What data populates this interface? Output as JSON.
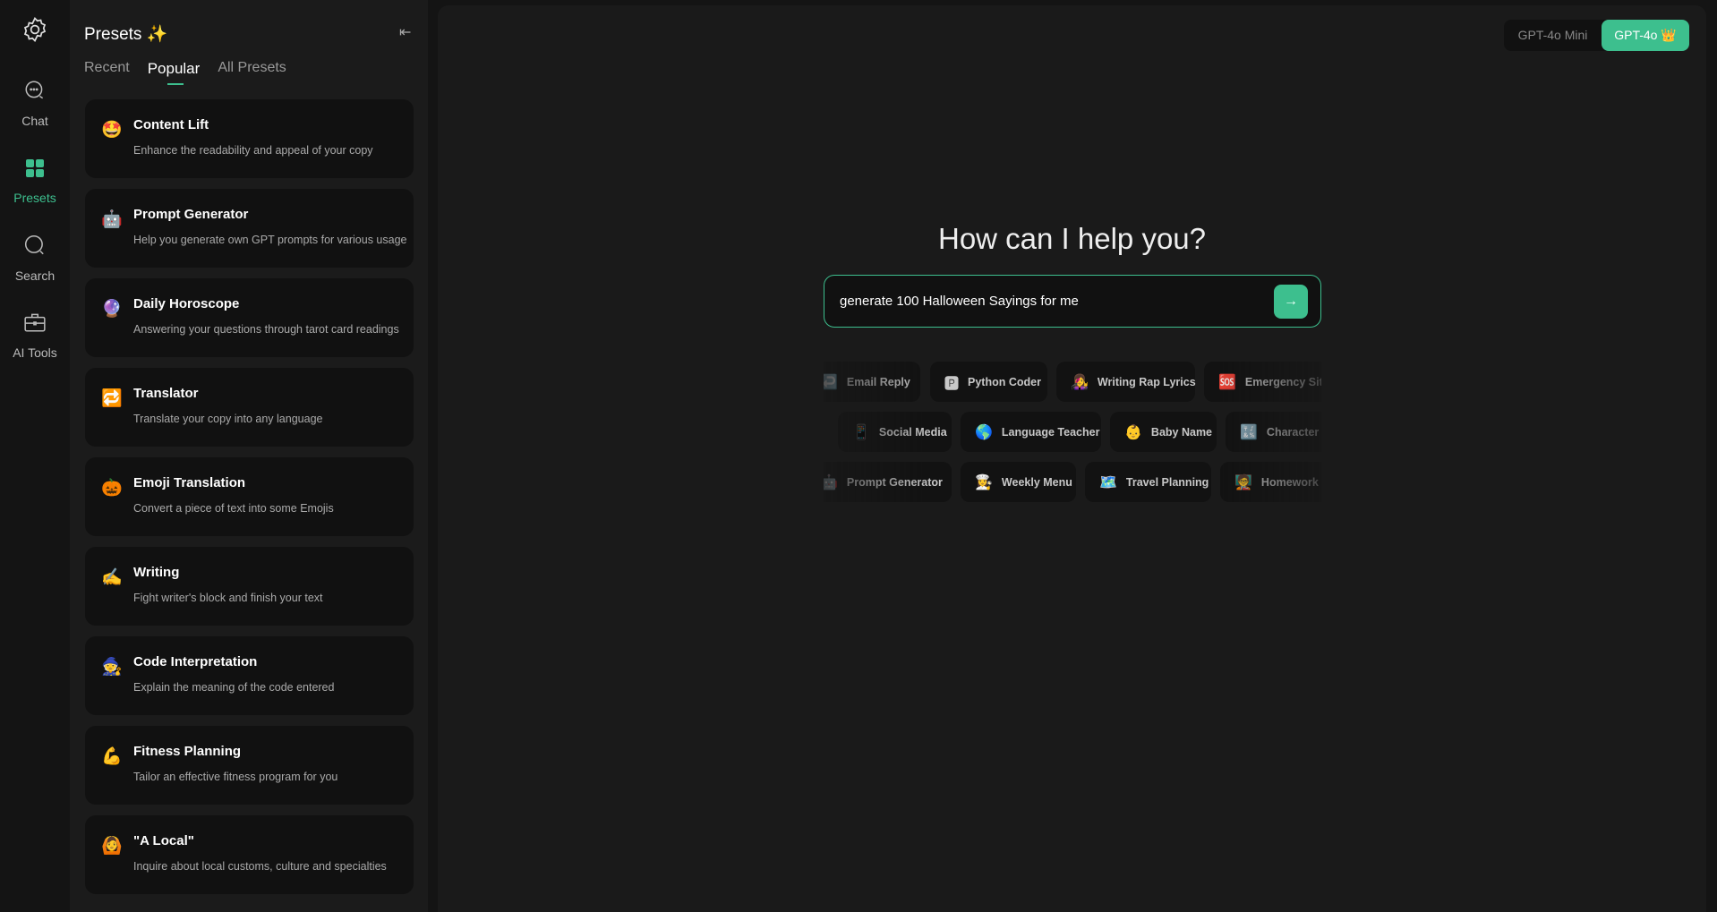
{
  "rail": {
    "settings_icon": "gear-icon",
    "items": [
      {
        "label": "Chat",
        "icon": "chat-bubble-icon"
      },
      {
        "label": "Presets",
        "icon": "grid-icon",
        "active": true
      },
      {
        "label": "Search",
        "icon": "search-icon"
      },
      {
        "label": "AI Tools",
        "icon": "toolbox-icon"
      }
    ]
  },
  "panel": {
    "title": "Presets ✨",
    "tabs": [
      "Recent",
      "Popular",
      "All Presets"
    ],
    "active_tab": "Popular",
    "cards": [
      {
        "emoji": "🤩",
        "title": "Content Lift",
        "desc": "Enhance the readability and appeal of your copy"
      },
      {
        "emoji": "🤖",
        "title": "Prompt Generator",
        "desc": "Help you generate own GPT prompts for various usage"
      },
      {
        "emoji": "🔮",
        "title": "Daily Horoscope",
        "desc": "Answering your questions through tarot card readings"
      },
      {
        "emoji": "🔁",
        "title": "Translator",
        "desc": "Translate your copy into any language"
      },
      {
        "emoji": "🎃",
        "title": "Emoji Translation",
        "desc": "Convert a piece of text into some Emojis"
      },
      {
        "emoji": "✍️",
        "title": "Writing",
        "desc": "Fight writer's block and finish your text"
      },
      {
        "emoji": "🧙",
        "title": "Code Interpretation",
        "desc": "Explain the meaning of the code entered"
      },
      {
        "emoji": "💪",
        "title": "Fitness Planning",
        "desc": "Tailor an effective fitness program for you"
      },
      {
        "emoji": "🙆",
        "title": "\"A Local\"",
        "desc": "Inquire about local customs, culture and specialties"
      }
    ]
  },
  "main": {
    "models": [
      "GPT-4o Mini",
      "GPT-4o 👑"
    ],
    "active_model": "GPT-4o 👑",
    "heading": "How can I help you?",
    "input_value": "generate 100 Halloween Sayings for me",
    "chips": [
      [
        {
          "emoji": "↩️",
          "label": "Email Reply"
        },
        {
          "emoji": "🅿",
          "label": "Python Coder"
        },
        {
          "emoji": "👩‍🎤",
          "label": "Writing Rap Lyrics"
        },
        {
          "emoji": "🆘",
          "label": "Emergency Situation"
        }
      ],
      [
        {
          "emoji": "📱",
          "label": "Social Media"
        },
        {
          "emoji": "🌎",
          "label": "Language Teacher"
        },
        {
          "emoji": "👶",
          "label": "Baby Name"
        },
        {
          "emoji": "🔣",
          "label": "Character Art"
        }
      ],
      [
        {
          "emoji": "🤖",
          "label": "Prompt Generator"
        },
        {
          "emoji": "👩‍🍳",
          "label": "Weekly Menu"
        },
        {
          "emoji": "🗺️",
          "label": "Travel Planning"
        },
        {
          "emoji": "🧑‍🏫",
          "label": "Homework Helper"
        }
      ]
    ]
  },
  "colors": {
    "accent": "#3dbf8e"
  }
}
